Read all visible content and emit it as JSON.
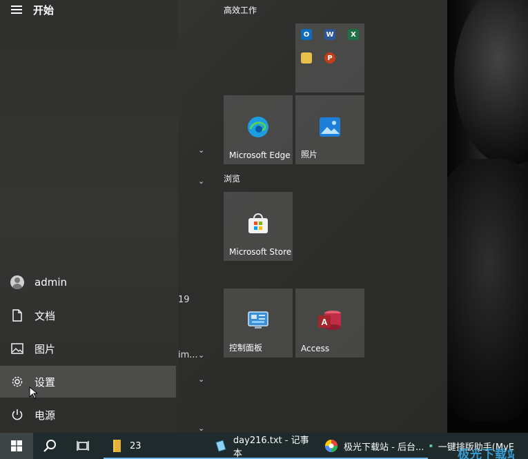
{
  "start_menu": {
    "title": "开始",
    "nav": {
      "user": "admin",
      "documents": "文档",
      "pictures": "图片",
      "settings": "设置",
      "power": "电源"
    },
    "app_list_fragments": {
      "number": "19",
      "truncated": "im..."
    }
  },
  "tiles": {
    "group1_title": "高效工作",
    "group2_title": "浏览",
    "edge": "Microsoft Edge",
    "photos": "照片",
    "store": "Microsoft Store",
    "control_panel": "控制面板",
    "access": "Access",
    "office_folder_apps": [
      "Outlook",
      "Word",
      "Excel",
      "File Explorer",
      "PowerPoint"
    ]
  },
  "taskbar": {
    "explorer_label": "23",
    "notepad_label": "day216.txt - 记事本",
    "browser_label": "极光下载站 - 后台...",
    "app_label": "一键排版助手(MyE",
    "watermark": "极光下载站"
  },
  "colors": {
    "accent": "#76b9ed",
    "tile_bg": "rgba(255,255,255,0.13)",
    "watermark": "#38a8e0"
  }
}
